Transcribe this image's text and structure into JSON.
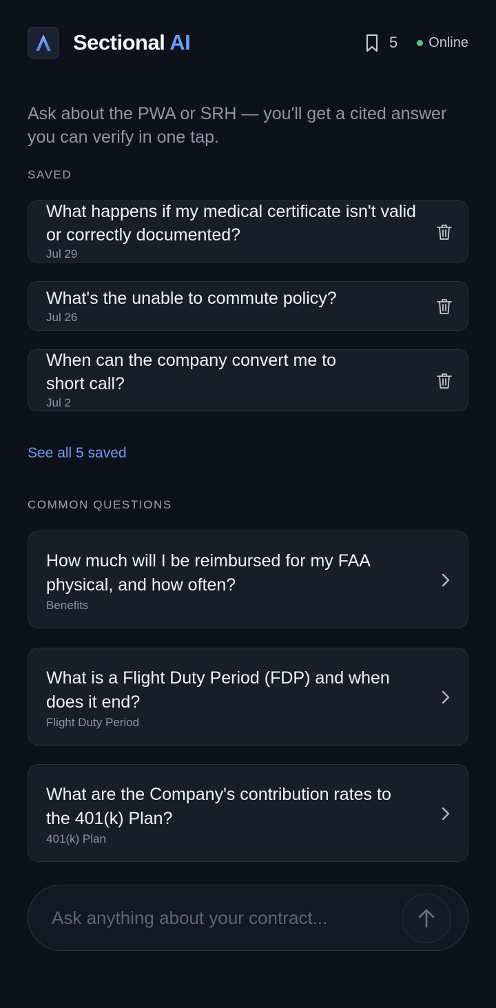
{
  "header": {
    "brand_main": "Sectional",
    "brand_accent": "AI",
    "logo_icon": "triangle-a-logo-icon",
    "saved_count": "5",
    "status": "Online",
    "status_color": "#5ec47e"
  },
  "intro": "Ask about the PWA or SRH — you'll get a cited answer you can verify in one tap.",
  "saved_section": {
    "label": "SAVED",
    "items": [
      {
        "question": "What happens if my medical certificate isn't valid or correctly documented?",
        "date": "Jul 29"
      },
      {
        "question": "What's the unable to commute policy?",
        "date": "Jul 26"
      },
      {
        "question": "When can the company convert me to short call?",
        "date": "Jul 2"
      }
    ],
    "see_all": "See all 5 saved"
  },
  "common_section": {
    "label": "COMMON QUESTIONS",
    "items": [
      {
        "question": "How much will I be reimbursed for my FAA physical, and how often?",
        "category": "Benefits"
      },
      {
        "question": "What is a Flight Duty Period (FDP) and when does it end?",
        "category": "Flight Duty Period"
      },
      {
        "question": "What are the Company's contribution rates to the 401(k) Plan?",
        "category": "401(k) Plan"
      }
    ]
  },
  "composer": {
    "placeholder": "Ask anything about your contract...",
    "value": ""
  },
  "colors": {
    "background": "#0d111b",
    "card": "#171d29",
    "accent": "#6f9df2",
    "muted_text": "#8e97a7"
  }
}
